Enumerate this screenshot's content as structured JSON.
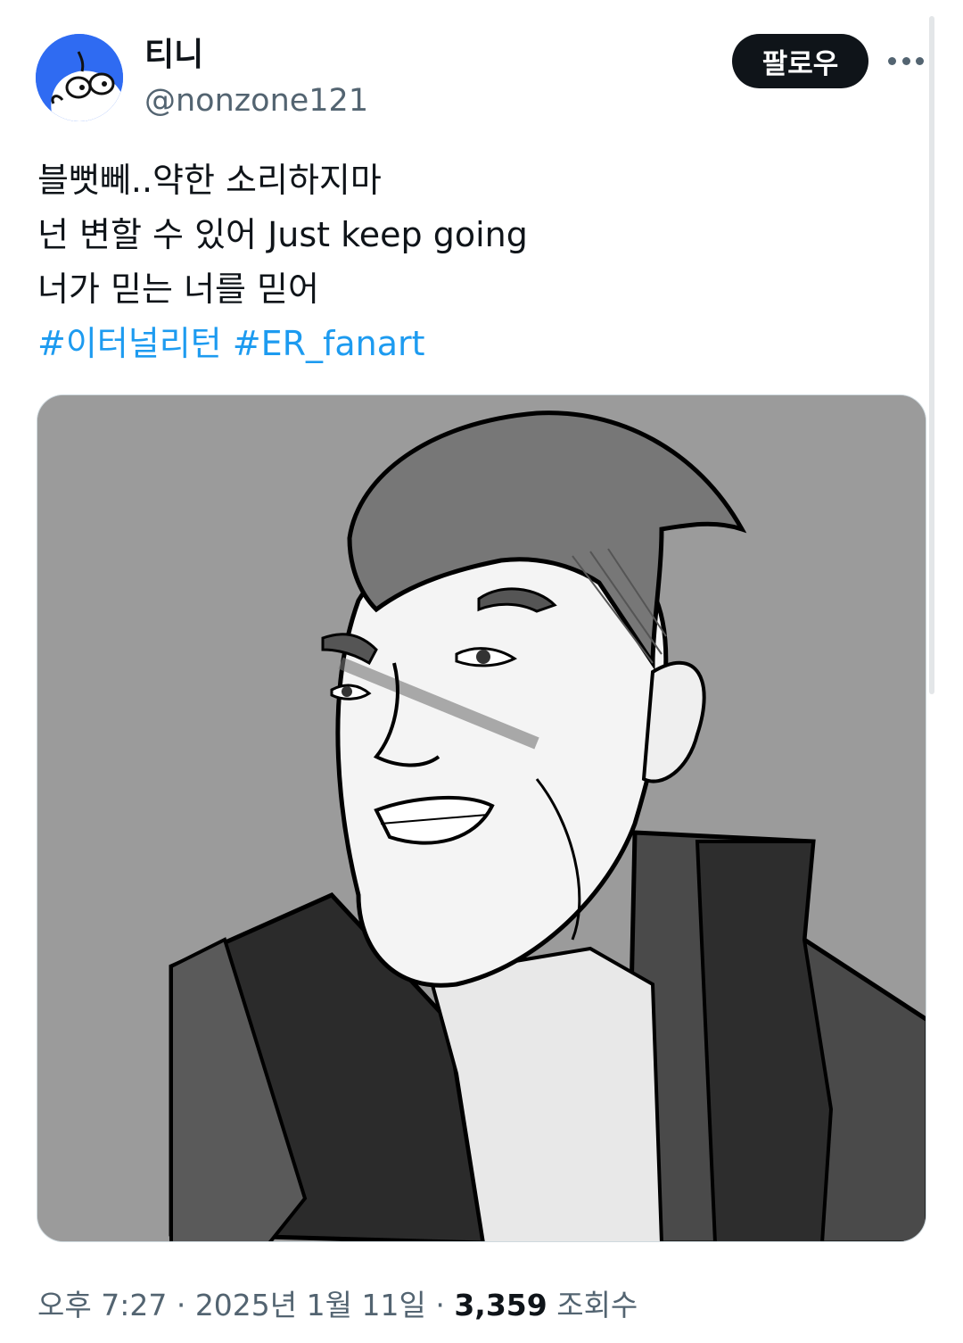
{
  "author": {
    "display_name": "티니",
    "handle": "@nonzone121"
  },
  "actions": {
    "follow_label": "팔로우",
    "more_icon": "more-horizontal-icon"
  },
  "tweet": {
    "lines": [
      "블뻣뻬..약한 소리하지마",
      "넌 변할 수 있어 Just keep going",
      "너가 믿는 너를 믿어"
    ],
    "hashtags": [
      "#이터널리턴",
      "#ER_fanart"
    ]
  },
  "meta": {
    "time": "오후 7:27",
    "sep1": " · ",
    "date": "2025년 1월 11일",
    "sep2": " · ",
    "views": "3,359",
    "views_label": " 조회수"
  },
  "colors": {
    "link": "#1d9bf0",
    "avatar_bg": "#2f6bf2",
    "follow_bg": "#0f1419"
  }
}
